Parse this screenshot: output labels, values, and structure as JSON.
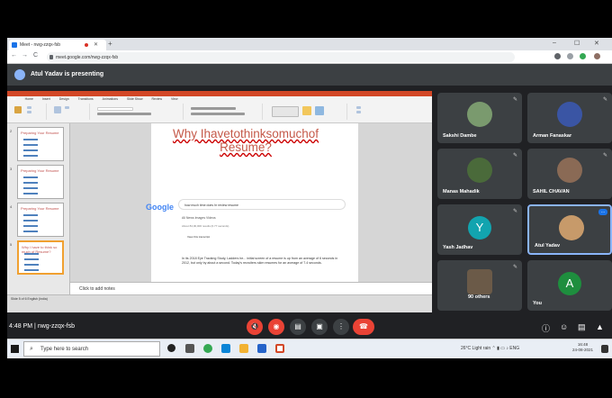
{
  "browser": {
    "tab_title": "Meet - nwg-zzqx-fsb",
    "new_tab": "+",
    "url": "meet.google.com/nwg-zzqx-fsb",
    "minimize": "–",
    "maximize": "☐",
    "close": "✕",
    "back": "←",
    "forward": "→",
    "reload": "C"
  },
  "presenting": {
    "text": "Atul Yadav is presenting"
  },
  "ppt": {
    "tabs": [
      "File",
      "Home",
      "Insert",
      "Design",
      "Transitions",
      "Animations",
      "Slide Show",
      "Review",
      "View"
    ],
    "slide_title": "Why Ihavetothinksomuchof Resume?",
    "thumbnails": [
      {
        "num": "2",
        "title": "Preparing Your Resume"
      },
      {
        "num": "3",
        "title": "Preparing Your Resume"
      },
      {
        "num": "4",
        "title": "Preparing Your Resume"
      },
      {
        "num": "5",
        "title": "Why I have to think so much of Resume?"
      }
    ],
    "google_logo": "Google",
    "search_query": "how much time does hr review resume",
    "search_tabs": "All  News  Images  Videos",
    "result_stats": "About 84,00,000 results (0.77 seconds)",
    "view_transcript": "View this transcript",
    "snippet": "In its 2018 Eye Tracking Study, Ladders he... initial screen of a resume is up from an average of 6 seconds in 2012, but only by about a second. Today's recruiters skim resumes for an average of 7.4 seconds.",
    "notes": "Click to add notes",
    "status": "Slide 5 of 6   English (India)"
  },
  "participants": [
    {
      "name": "Sakshi Dambe",
      "type": "photo",
      "color": "#7a9a6e"
    },
    {
      "name": "Arman Fanaskar",
      "type": "photo",
      "color": "#3a55a4"
    },
    {
      "name": "Manas Mahadik",
      "type": "photo",
      "color": "#4a6a3a"
    },
    {
      "name": "SAHIL CHAVAN",
      "type": "photo",
      "color": "#8a6a55"
    },
    {
      "name": "Yash Jadhav",
      "type": "letter",
      "letter": "Y",
      "color": "#12a4af"
    },
    {
      "name": "Atul Yadav",
      "type": "photo",
      "color": "#c79a6a"
    },
    {
      "name": "90 others",
      "type": "group",
      "color": "#6b5a48"
    },
    {
      "name": "You",
      "type": "letter",
      "letter": "A",
      "color": "#1e8e3e"
    }
  ],
  "meeting": {
    "time": "4:48 PM",
    "separator": "|",
    "code": "nwg-zzqx-fsb"
  },
  "taskbar": {
    "search_placeholder": "Type here to search",
    "weather": "26°C  Light rain",
    "lang": "ENG",
    "time": "16:48",
    "date": "24-08-2021"
  }
}
